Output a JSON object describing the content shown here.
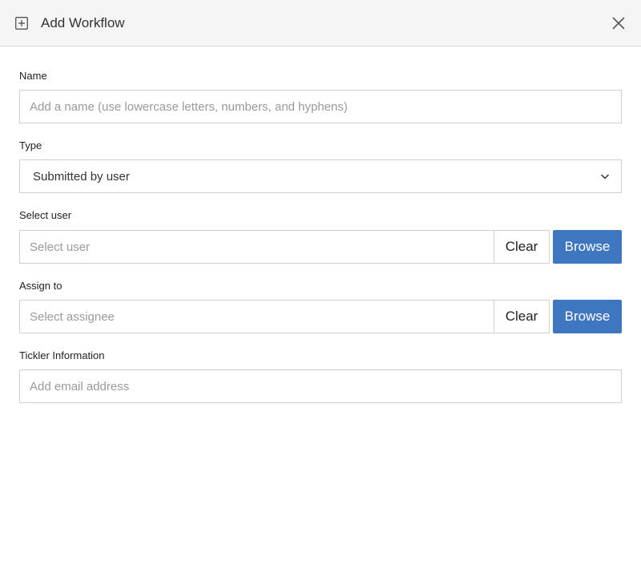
{
  "dialog": {
    "title": "Add Workflow",
    "header_icon": "plus-square-icon",
    "close_icon": "close-icon"
  },
  "fields": {
    "name": {
      "label": "Name",
      "placeholder": "Add a name (use lowercase letters, numbers, and hyphens)",
      "value": ""
    },
    "type": {
      "label": "Type",
      "selected": "Submitted by user",
      "icon": "chevron-down-icon"
    },
    "select_user": {
      "label": "Select user",
      "placeholder": "Select user",
      "value": "",
      "clear_label": "Clear",
      "browse_label": "Browse"
    },
    "assign_to": {
      "label": "Assign to",
      "placeholder": "Select assignee",
      "value": "",
      "clear_label": "Clear",
      "browse_label": "Browse"
    },
    "tickler": {
      "label": "Tickler Information",
      "placeholder": "Add email address",
      "value": ""
    }
  },
  "colors": {
    "header_bg": "#f5f5f5",
    "primary_button": "#3e77bf",
    "border": "#cfcfcf"
  }
}
